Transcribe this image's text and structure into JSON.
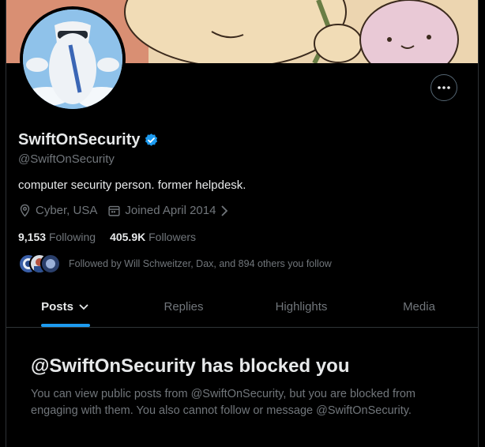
{
  "profile": {
    "display_name": "SwiftOnSecurity",
    "verified": true,
    "handle": "@SwiftOnSecurity",
    "bio": "computer security person. former helpdesk.",
    "location": "Cyber, USA",
    "joined": "Joined April 2014",
    "following_count": "9,153",
    "following_label": "Following",
    "followers_count": "405.9K",
    "followers_label": "Followers",
    "followed_by": "Followed by Will Schweitzer, Dax, and 894 others you follow"
  },
  "icons": {
    "more": "more-dots-icon",
    "verified": "verified-badge-icon",
    "location": "location-pin-icon",
    "calendar": "calendar-icon",
    "chevron": "chevron-right-icon",
    "tab_dropdown": "chevron-down-icon"
  },
  "tabs": [
    {
      "label": "Posts",
      "active": true
    },
    {
      "label": "Replies",
      "active": false
    },
    {
      "label": "Highlights",
      "active": false
    },
    {
      "label": "Media",
      "active": false
    }
  ],
  "blocked": {
    "title": "@SwiftOnSecurity has blocked you",
    "message": "You can view public posts from @SwiftOnSecurity, but you are blocked from engaging with them. You also cannot follow or message @SwiftOnSecurity."
  },
  "colors": {
    "accent": "#1d9bf0",
    "background": "#000000",
    "text_primary": "#e7e9ea",
    "text_secondary": "#71767b",
    "border": "#2f3336"
  }
}
